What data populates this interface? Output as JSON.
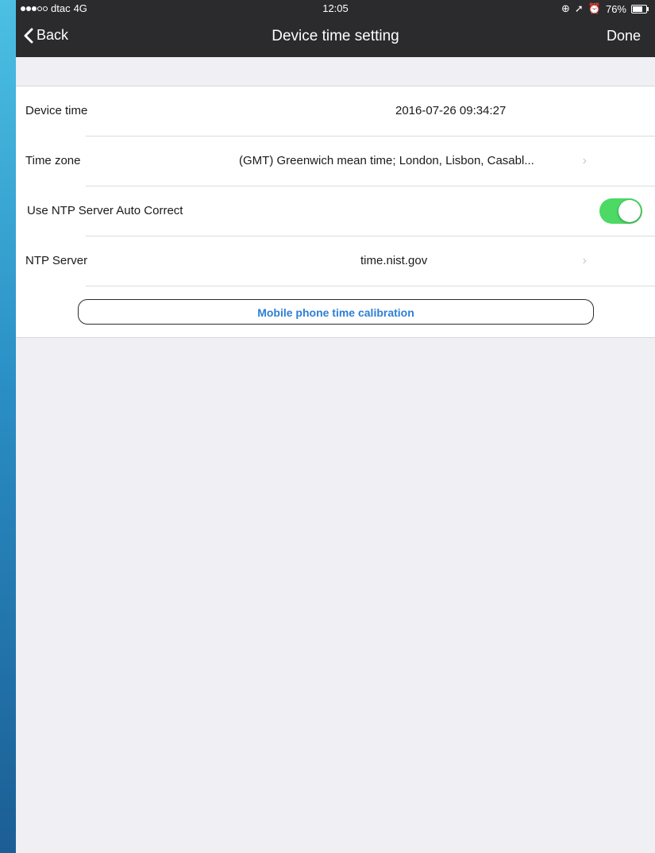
{
  "status_bar": {
    "carrier": "dtac",
    "network": "4G",
    "time": "12:05",
    "battery": "76%",
    "battery_level": 0.76
  },
  "nav": {
    "back_label": "Back",
    "title": "Device time setting",
    "done_label": "Done"
  },
  "settings": {
    "device_time": {
      "label": "Device time",
      "value": "2016-07-26 09:34:27"
    },
    "time_zone": {
      "label": "Time zone",
      "value": "(GMT) Greenwich mean time; London, Lisbon, Casabl..."
    },
    "ntp_auto": {
      "label": "Use NTP Server Auto Correct",
      "enabled": true
    },
    "ntp_server": {
      "label": "NTP Server",
      "value": "time.nist.gov"
    },
    "calibration_button": "Mobile phone time calibration"
  },
  "colors": {
    "toggle_on": "#4cd964",
    "link_blue": "#2d7fd6",
    "nav_bg": "#2b2b2d"
  }
}
